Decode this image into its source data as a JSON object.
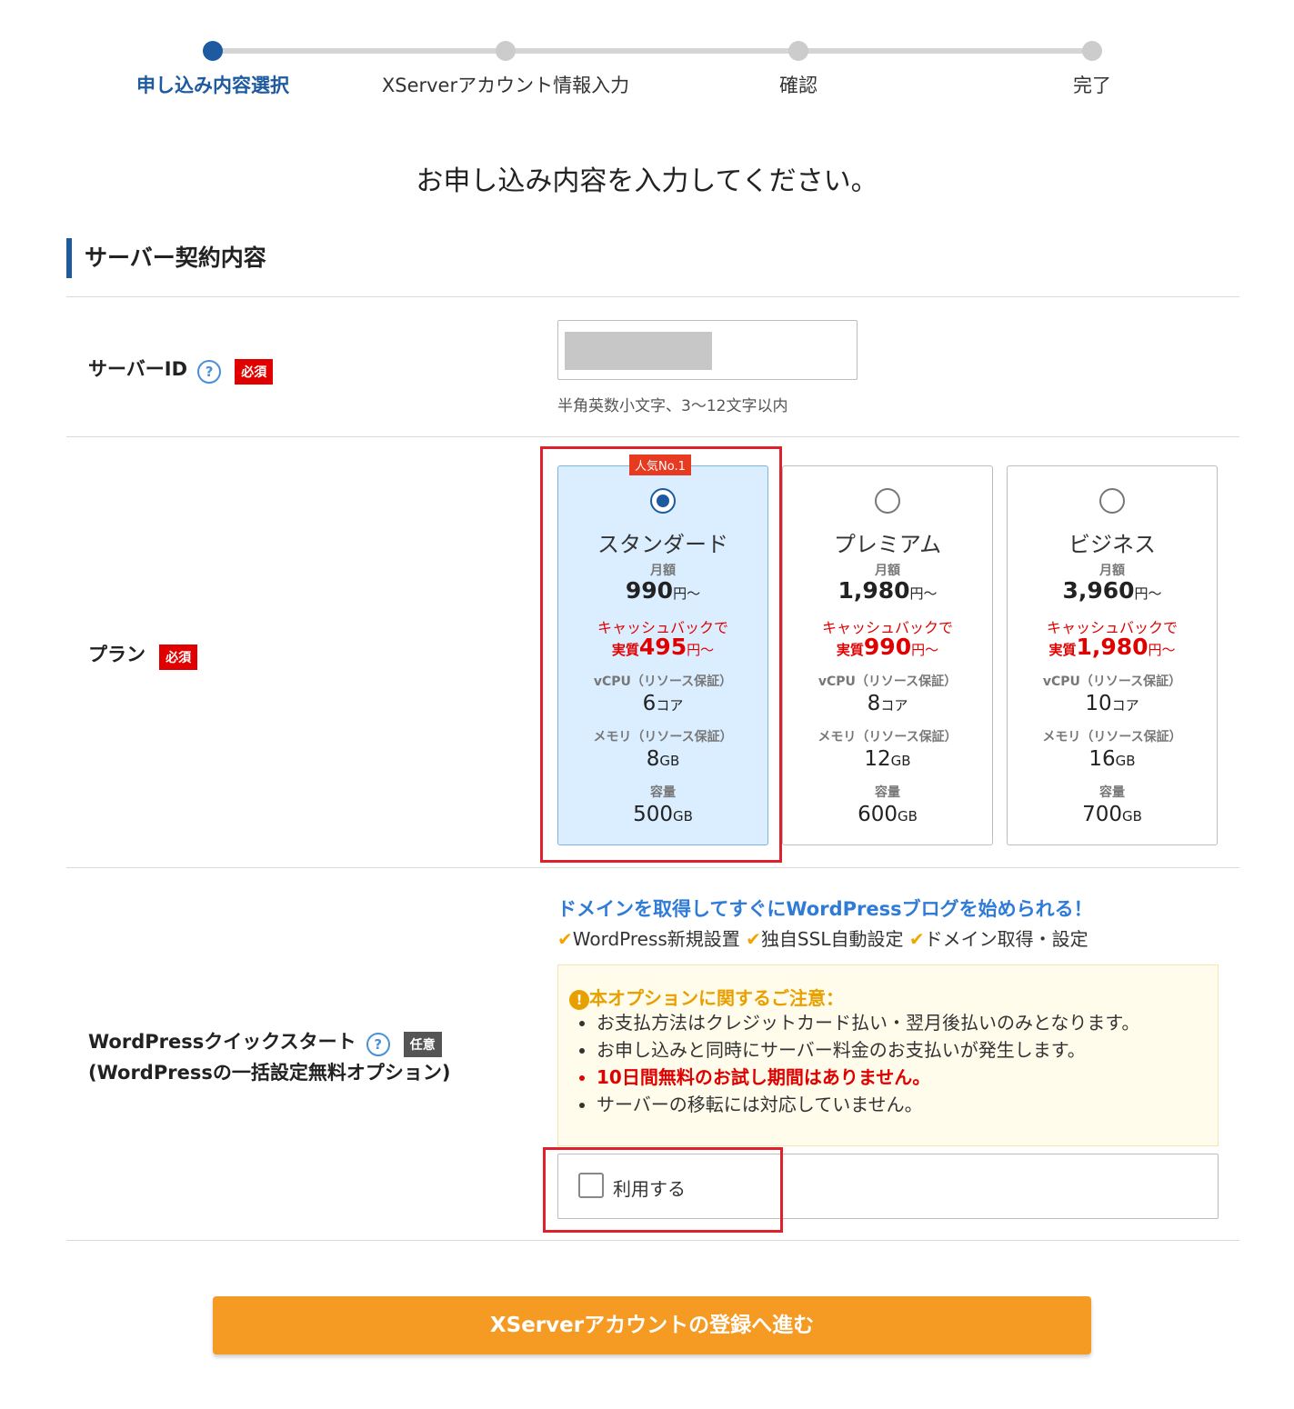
{
  "stepper": {
    "steps": [
      "申し込み内容選択",
      "XServerアカウント情報入力",
      "確認",
      "完了"
    ],
    "active_index": 0
  },
  "page_title": "お申し込み内容を入力してください。",
  "section_title": "サーバー契約内容",
  "server_id": {
    "label": "サーバーID",
    "help_icon": "?",
    "required": "必須",
    "hint": "半角英数小文字、3〜12文字以内"
  },
  "plan": {
    "label": "プラン",
    "required": "必須",
    "badge": "人気No.1",
    "selected": "スタンダード",
    "labels": {
      "monthly": "月額",
      "cashback": "キャッシュバックで",
      "real": "実質",
      "vcpu": "vCPU（リソース保証）",
      "memory": "メモリ（リソース保証）",
      "capacity": "容量",
      "yen": "円〜",
      "core": "コア",
      "gb": "GB"
    },
    "cards": [
      {
        "name": "スタンダード",
        "price": "990",
        "real_price": "495",
        "vcpu": "6",
        "memory": "8",
        "capacity": "500"
      },
      {
        "name": "プレミアム",
        "price": "1,980",
        "real_price": "990",
        "vcpu": "8",
        "memory": "12",
        "capacity": "600"
      },
      {
        "name": "ビジネス",
        "price": "3,960",
        "real_price": "1,980",
        "vcpu": "10",
        "memory": "16",
        "capacity": "700"
      }
    ]
  },
  "wordpress": {
    "label": "WordPressクイックスタート",
    "sub_label": "(WordPressの一括設定無料オプション)",
    "optional": "任意",
    "promo": "ドメインを取得してすぐにWordPressブログを始められる！",
    "checks": [
      "WordPress新規設置",
      "独自SSL自動設定",
      "ドメイン取得・設定"
    ],
    "check_mark": "✔",
    "notice_title": "本オプションに関するご注意：",
    "notice_icon": "!",
    "notice_items": [
      "お支払方法はクレジットカード払い・翌月後払いのみとなります。",
      "お申し込みと同時にサーバー料金のお支払いが発生します。",
      "10日間無料のお試し期間はありません。",
      "サーバーの移転には対応していません。"
    ],
    "use_label": "利用する",
    "use_checked": false
  },
  "submit_label": "XServerアカウントの登録へ進む",
  "colors": {
    "accent": "#1e5aa0",
    "required": "#e00000",
    "submit": "#f59a23",
    "highlight_box": "#e0202c"
  }
}
